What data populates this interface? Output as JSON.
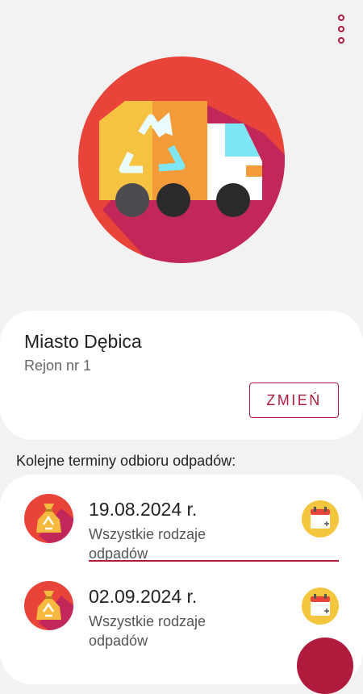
{
  "location": {
    "city": "Miasto Dębica",
    "region": "Rejon nr 1",
    "change_label": "ZMIEŃ"
  },
  "schedule": {
    "title": "Kolejne terminy odbioru odpadów:",
    "items": [
      {
        "date": "19.08.2024 r.",
        "type": "Wszystkie rodzaje odpadów"
      },
      {
        "date": "02.09.2024 r.",
        "type": "Wszystkie rodzaje odpadów"
      }
    ]
  },
  "colors": {
    "accent": "#b01a3c",
    "hero_circle": "#e8443a",
    "hero_shadow": "#c2275a",
    "truck_yellow": "#f5c242",
    "truck_orange": "#f29b38",
    "bag_yellow": "#f4b93e"
  },
  "icons": {
    "menu": "more-vertical-icon",
    "hero": "garbage-truck-icon",
    "bag": "recycling-bag-icon",
    "calendar": "calendar-add-icon"
  }
}
